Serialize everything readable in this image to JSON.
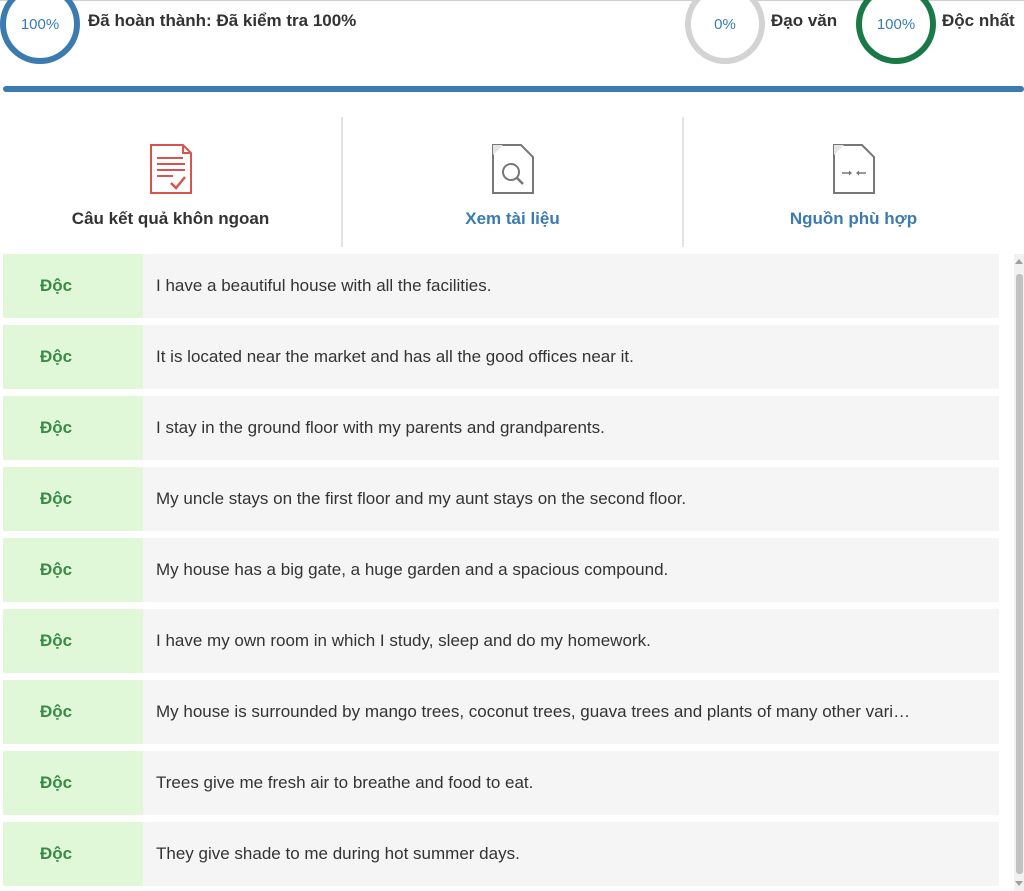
{
  "stats": {
    "completion": {
      "ring_text": "100%",
      "label": "Đã hoàn thành: Đã kiểm tra 100%"
    },
    "plagiarism": {
      "ring_text": "0%",
      "label": "Đạo văn"
    },
    "unique": {
      "ring_text": "100%",
      "label": "Độc nhất"
    }
  },
  "tabs": [
    {
      "label": "Câu kết quả khôn ngoan",
      "icon": "report-check-icon",
      "active": true
    },
    {
      "label": "Xem tài liệu",
      "icon": "document-search-icon",
      "active": false
    },
    {
      "label": "Nguồn phù hợp",
      "icon": "document-compare-icon",
      "active": false
    }
  ],
  "rows": [
    {
      "tag": "Độc",
      "text": "I have a beautiful house with all the facilities."
    },
    {
      "tag": "Độc",
      "text": "It is located near the market and has all the good offices near it."
    },
    {
      "tag": "Độc",
      "text": "I stay in the ground floor with my parents and grandparents."
    },
    {
      "tag": "Độc",
      "text": "My uncle stays on the first floor and my aunt stays on the second floor."
    },
    {
      "tag": "Độc",
      "text": "My house has a big gate, a huge garden and a spacious compound."
    },
    {
      "tag": "Độc",
      "text": "I have my own room in which I study, sleep and do my homework."
    },
    {
      "tag": "Độc",
      "text": "My house is surrounded by mango trees, coconut trees, guava trees and plants of many other vari…"
    },
    {
      "tag": "Độc",
      "text": "Trees give me fresh air to breathe and food to eat."
    },
    {
      "tag": "Độc",
      "text": "They give shade to me during hot summer days."
    }
  ],
  "colors": {
    "accent_blue": "#3b7bb0",
    "unique_green": "#197a47",
    "tag_bg": "#e0f8d8",
    "tag_text": "#3a8a4a",
    "report_icon_red": "#d9534f"
  }
}
